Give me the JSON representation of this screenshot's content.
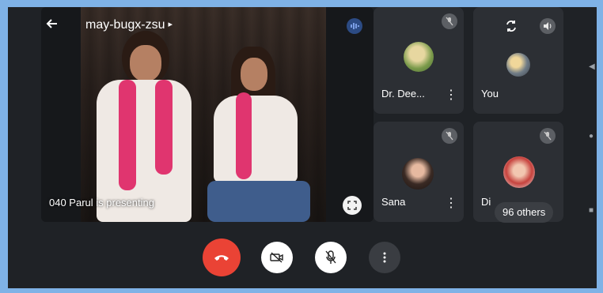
{
  "header": {
    "meeting_code": "may-bugx-zsu"
  },
  "presentation": {
    "presenter_label": "040 Parul is presenting"
  },
  "participants": [
    {
      "name": "Dr. Dee...",
      "muted": true
    },
    {
      "name": "You",
      "muted": false
    },
    {
      "name": "Sana",
      "muted": true
    },
    {
      "name": "Di",
      "muted": true
    }
  ],
  "others_label": "96 others",
  "icons": {
    "back": "arrow-left-icon",
    "speaking": "audio-wave-icon",
    "fullscreen": "fullscreen-icon",
    "switch_camera": "switch-camera-icon",
    "speaker": "speaker-icon",
    "mic_off": "mic-off-icon",
    "more": "more-vertical-icon",
    "end_call": "end-call-icon",
    "camera_off": "camera-off-icon"
  },
  "colors": {
    "end_call": "#ea4335",
    "background": "#1f2226",
    "tile": "#2c2f34",
    "accent_blue": "#2c4b84"
  }
}
